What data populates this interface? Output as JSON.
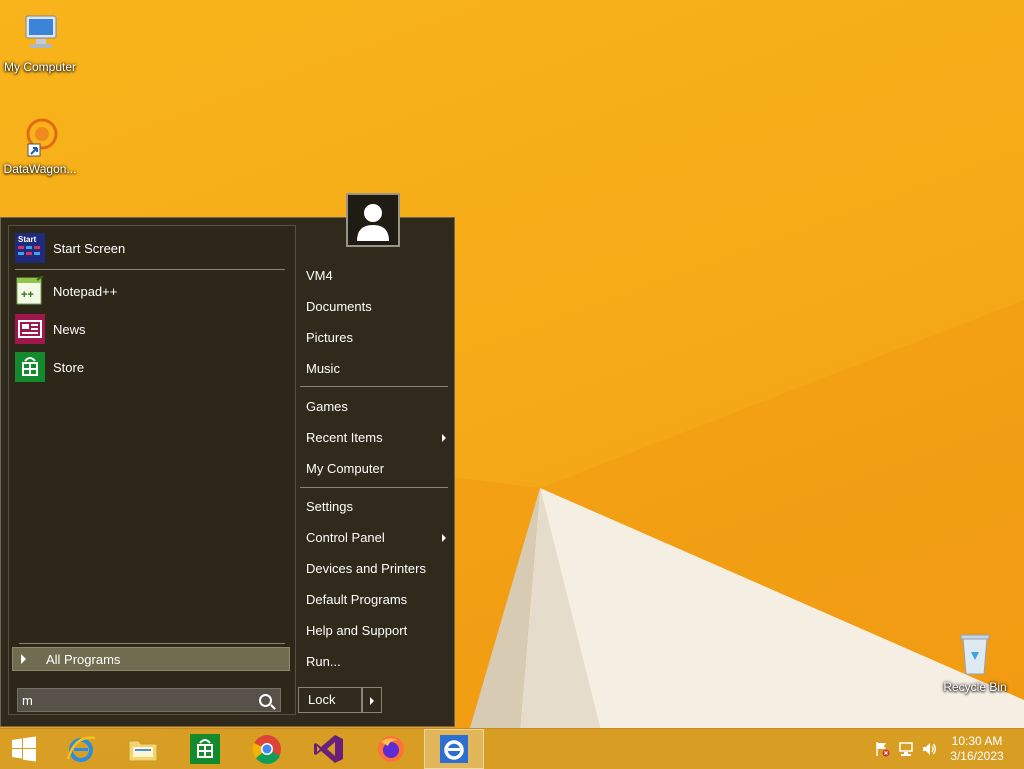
{
  "desktop": {
    "icons": [
      {
        "label": "My Computer"
      },
      {
        "label": "DataWagon..."
      },
      {
        "label": "Recycle Bin"
      }
    ]
  },
  "start_menu": {
    "pinned": [
      {
        "label": "Start Screen",
        "icon": "start-screen-icon"
      },
      {
        "label": "Notepad++",
        "icon": "notepadpp-icon"
      },
      {
        "label": "News",
        "icon": "news-icon"
      },
      {
        "label": "Store",
        "icon": "store-icon"
      }
    ],
    "all_programs": "All Programs",
    "search_value": "m",
    "right": {
      "user": "VM4",
      "documents": "Documents",
      "pictures": "Pictures",
      "music": "Music",
      "games": "Games",
      "recent_items": "Recent Items",
      "my_computer": "My Computer",
      "settings": "Settings",
      "control_panel": "Control Panel",
      "devices_printers": "Devices and Printers",
      "default_programs": "Default Programs",
      "help_support": "Help and Support",
      "run": "Run..."
    },
    "lock": "Lock"
  },
  "taskbar": {
    "apps": [
      "start-button",
      "internet-explorer",
      "file-explorer",
      "store",
      "chrome",
      "visual-studio",
      "firefox",
      "internet-explorer-active"
    ],
    "time": "10:30 AM",
    "date": "3/16/2023"
  },
  "colors": {
    "accent": "#f5a816",
    "menu_bg": "#2f2a1c",
    "highlight": "#6f6c50"
  }
}
